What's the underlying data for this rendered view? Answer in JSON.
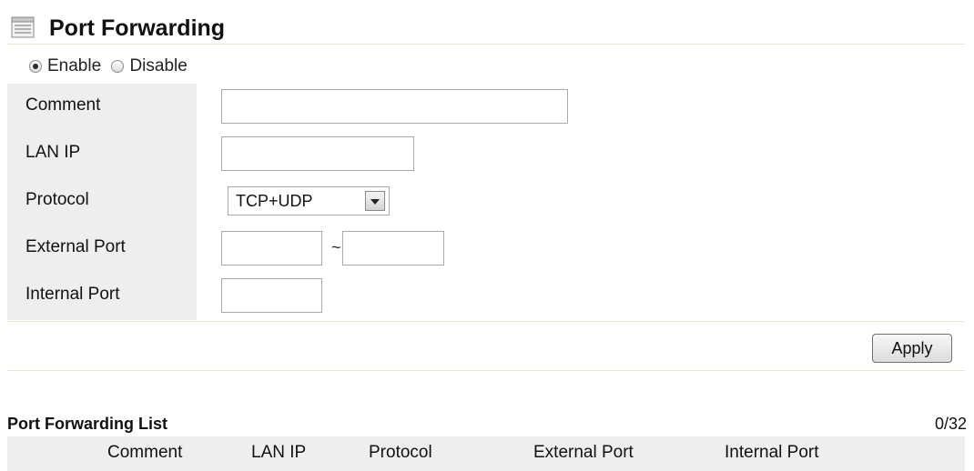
{
  "header": {
    "title": "Port Forwarding",
    "icon": "page-icon"
  },
  "status": {
    "enable_label": "Enable",
    "disable_label": "Disable",
    "selected": "Enable"
  },
  "form": {
    "comment": {
      "label": "Comment",
      "value": ""
    },
    "lan_ip": {
      "label": "LAN IP",
      "value": ""
    },
    "protocol": {
      "label": "Protocol",
      "value": "TCP+UDP"
    },
    "external_port": {
      "label": "External Port",
      "from": "",
      "separator": "~",
      "to": ""
    },
    "internal_port": {
      "label": "Internal Port",
      "value": ""
    }
  },
  "actions": {
    "apply_label": "Apply"
  },
  "list": {
    "title": "Port Forwarding List",
    "count": "0/32",
    "columns": [
      "Comment",
      "LAN IP",
      "Protocol",
      "External Port",
      "Internal Port"
    ],
    "rows": []
  },
  "colors": {
    "label_bg": "#eeeeee",
    "divider": "#e6e6d2",
    "border": "#a9a9a9"
  }
}
